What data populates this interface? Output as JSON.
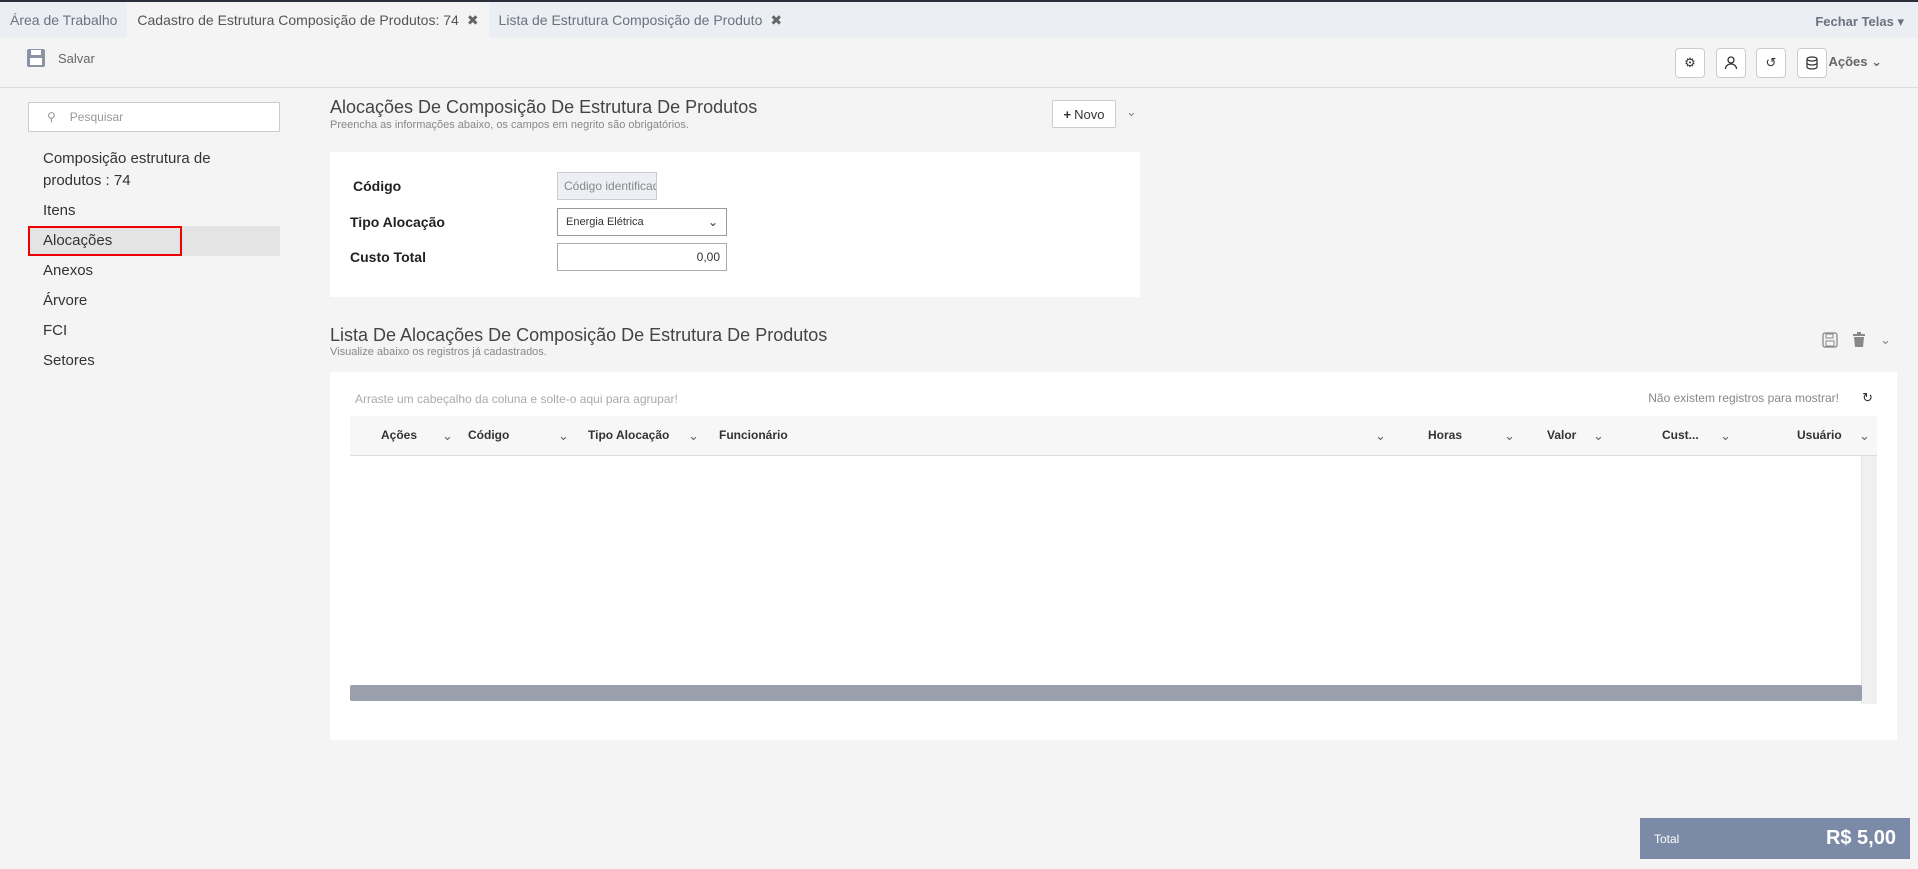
{
  "tabs": [
    {
      "label": "Área de Trabalho"
    },
    {
      "label": "Cadastro de Estrutura Composição de Produtos: 74"
    },
    {
      "label": "Lista de Estrutura Composição de Produto"
    }
  ],
  "fechar_telas": "Fechar Telas",
  "toolbar": {
    "save_label": "Salvar",
    "acoes_label": "Ações"
  },
  "sidebar": {
    "search_placeholder": "Pesquisar",
    "items": [
      {
        "label": "Composição estrutura de produtos : 74"
      },
      {
        "label": "Itens"
      },
      {
        "label": "Alocações"
      },
      {
        "label": "Anexos"
      },
      {
        "label": "Árvore"
      },
      {
        "label": "FCI"
      },
      {
        "label": "Setores"
      }
    ]
  },
  "form": {
    "title": "Alocações De Composição De Estrutura De Produtos",
    "subtitle": "Preencha as informações abaixo, os campos em negrito são obrigatórios.",
    "novo_label": "Novo",
    "codigo_label": "Código",
    "codigo_placeholder": "Código identificador",
    "tipo_label": "Tipo Alocação",
    "tipo_value": "Energia Elétrica",
    "custo_label": "Custo Total",
    "custo_value": "0,00"
  },
  "list": {
    "title": "Lista De Alocações De Composição De Estrutura De Produtos",
    "subtitle": "Visualize abaixo os registros já cadastrados.",
    "group_hint": "Arraste um cabeçalho da coluna e solte-o aqui para agrupar!",
    "no_records": "Não existem registros para mostrar!",
    "columns": [
      "Ações",
      "Código",
      "Tipo Alocação",
      "Funcionário",
      "Horas",
      "Valor",
      "Cust...",
      "Usuário"
    ]
  },
  "total": {
    "label": "Total",
    "value": "R$ 5,00"
  }
}
